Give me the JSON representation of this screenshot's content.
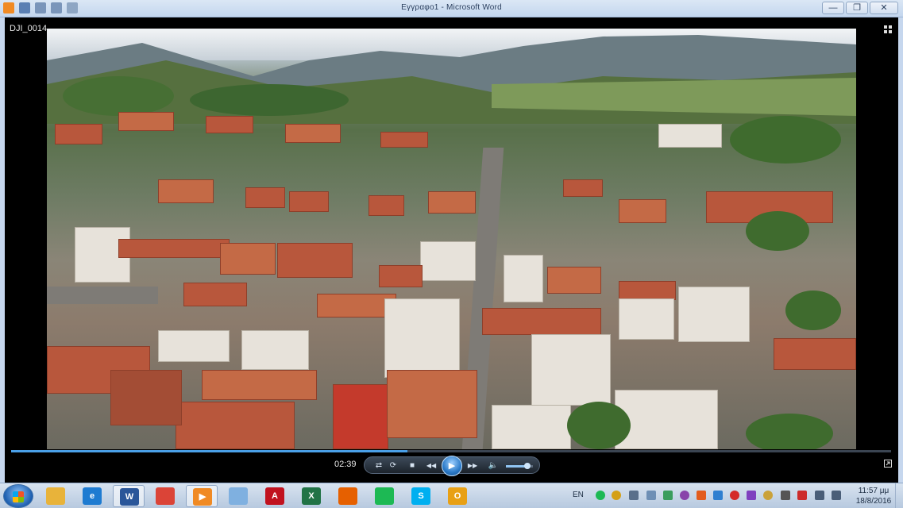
{
  "window": {
    "title": "Εγγραφο1 - Microsoft Word",
    "minimize_label": "—",
    "restore_label": "❐",
    "close_label": "✕"
  },
  "player": {
    "clip_name": "DJI_0014",
    "current_time": "02:39",
    "progress": 0.45,
    "volume": 0.8
  },
  "controls": {
    "repeat_icon": "⟳",
    "shuffle_icon": "⇄",
    "stop_icon": "■",
    "prev_icon": "◀◀",
    "play_icon": "▶",
    "next_icon": "▶▶",
    "volume_icon": "🔈"
  },
  "taskbar": {
    "apps": [
      {
        "name": "file-explorer",
        "glyph": "",
        "color": "#e8b33a",
        "active": false
      },
      {
        "name": "internet-explorer",
        "glyph": "e",
        "color": "#1e7bd1",
        "active": false
      },
      {
        "name": "word",
        "glyph": "W",
        "color": "#2a5699",
        "active": true
      },
      {
        "name": "chrome",
        "glyph": "",
        "color": "#db4437",
        "active": false
      },
      {
        "name": "media-player",
        "glyph": "▶",
        "color": "#f08a24",
        "active": true
      },
      {
        "name": "notepad",
        "glyph": "",
        "color": "#7fb0e0",
        "active": false
      },
      {
        "name": "acrobat",
        "glyph": "A",
        "color": "#c1121f",
        "active": false
      },
      {
        "name": "excel",
        "glyph": "X",
        "color": "#217346",
        "active": false
      },
      {
        "name": "firefox",
        "glyph": "",
        "color": "#e66000",
        "active": false
      },
      {
        "name": "spotify",
        "glyph": "",
        "color": "#1db954",
        "active": false
      },
      {
        "name": "skype",
        "glyph": "S",
        "color": "#00aff0",
        "active": false
      },
      {
        "name": "outlook",
        "glyph": "O",
        "color": "#e8a015",
        "active": false
      }
    ],
    "language": "EN",
    "time": "11:57 μμ",
    "date": "18/8/2016"
  },
  "colors": {
    "accent": "#4aa0e8",
    "taskbar": "#c7d6ea"
  }
}
